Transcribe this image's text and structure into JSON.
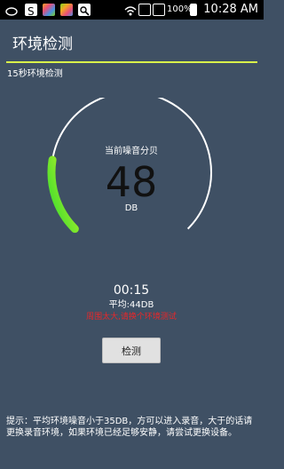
{
  "status_bar": {
    "battery_percent": "100%",
    "time": "10:28 AM",
    "icons": [
      "notification-icon",
      "s-app-icon",
      "photos-icon",
      "photos-icon",
      "image-icon",
      "wifi-icon",
      "sim-icon",
      "sim-icon",
      "battery-icon"
    ]
  },
  "header": {
    "title": "环境检测"
  },
  "section_label": "15秒环境检测",
  "gauge": {
    "caption": "当前噪音分贝",
    "value": "48",
    "unit": "DB",
    "level_fraction": 0.2,
    "gradient_start": "#2fdc2f",
    "gradient_end": "#ccf028",
    "track_color": "#ffffff"
  },
  "timer": "00:15",
  "average": "平均:44DB",
  "warning": "周围太大,请换个环境测试",
  "buttons": {
    "detect": "检测"
  },
  "hint": "提示：平均环境噪音小于35DB，方可以进入录音，大于的话请更换录音环境，如果环境已经足够安静，请尝试更换设备。"
}
